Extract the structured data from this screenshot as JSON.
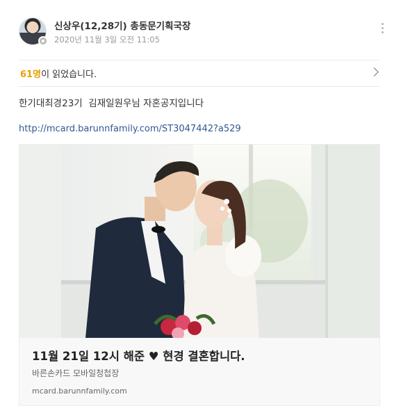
{
  "post": {
    "author": "신상우(12,28기) 총동문기획국장",
    "date": "2020년 11월 3일 오전 11:05",
    "read_count": "61명",
    "read_suffix": "이 읽었습니다.",
    "body": "한기대최경23기  김재일원우님 자혼공지입니다",
    "link": "http://mcard.barunnfamily.com/ST3047442?a529"
  },
  "link_preview": {
    "title": "11월 21일 12시 해준 ♥ 현경 결혼합니다.",
    "subtitle": "바른손카드 모바일청첩장",
    "domain": "mcard.barunnfamily.com"
  },
  "colors": {
    "read_count": "#e9a000",
    "link": "#2d5a91",
    "card_bg": "#f8f8f8"
  },
  "icons": [
    "avatar-photo",
    "verified-badge-icon",
    "more-vertical-icon",
    "chevron-right-icon"
  ]
}
